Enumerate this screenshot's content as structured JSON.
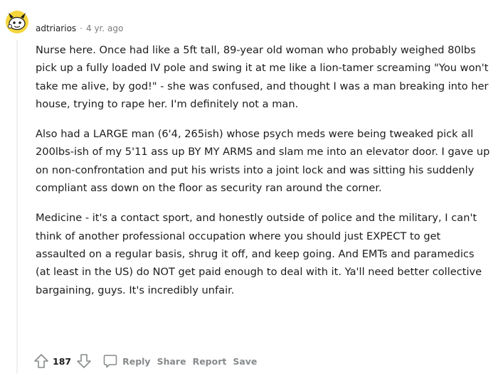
{
  "comment": {
    "username": "adtriarios",
    "separator": "·",
    "time": "4 yr. ago",
    "paragraphs": [
      "Nurse here. Once had like a 5ft tall, 89-year old woman who probably weighed 80lbs pick up a fully loaded IV pole and swing it at me like a lion-tamer screaming \"You won't take me alive, by god!\" - she was confused, and thought I was a man breaking into her house, trying to rape her. I'm definitely not a man.",
      "Also had a LARGE man (6'4, 265ish) whose psych meds were being tweaked pick all 200lbs-ish of my 5'11 ass up BY MY ARMS and slam me into an elevator door. I gave up on non-confrontation and put his wrists into a joint lock and was sitting his suddenly compliant ass down on the floor as security ran around the corner.",
      "Medicine - it's a contact sport, and honestly outside of police and the military, I can't think of another professional occupation where you should just EXPECT to get assaulted on a regular basis, shrug it off, and keep going. And EMTs and paramedics (at least in the US) do NOT get paid enough to deal with it. Ya'll need better collective bargaining, guys. It's incredibly unfair."
    ],
    "score": "187",
    "actions": {
      "reply": "Reply",
      "share": "Share",
      "report": "Report",
      "save": "Save"
    }
  },
  "icons": {
    "avatar": "snoo-avatar",
    "upvote": "upvote-arrow-icon",
    "downvote": "downvote-arrow-icon",
    "reply": "comment-bubble-icon"
  },
  "colors": {
    "text": "#1c1c1c",
    "meta": "#7c7c7c",
    "action": "#878a8c",
    "avatar_yellow": "#f5d63d"
  }
}
